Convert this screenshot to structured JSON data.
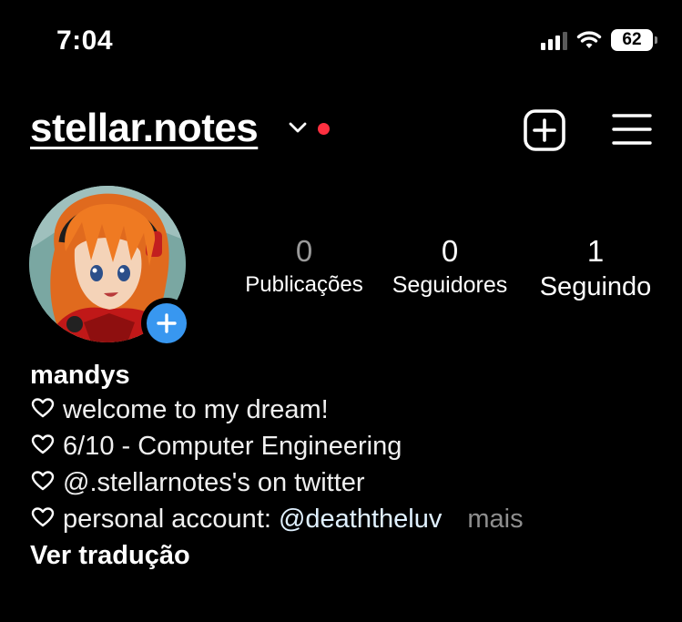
{
  "status_bar": {
    "time": "7:04",
    "battery": "62",
    "icons": [
      "signal-icon",
      "wifi-icon",
      "battery-icon"
    ]
  },
  "header": {
    "username": "stellar.notes",
    "icons": [
      "chevron-down-icon",
      "notification-dot-icon",
      "create-post-icon",
      "menu-icon"
    ],
    "accent_color": "#ff3040"
  },
  "profile": {
    "avatar": "anime-character-avatar",
    "add_story_color": "#3897f0"
  },
  "stats": {
    "posts": {
      "value": "0",
      "label": "Publicações"
    },
    "followers": {
      "value": "0",
      "label": "Seguidores"
    },
    "following": {
      "value": "1",
      "label": "Seguindo"
    }
  },
  "bio": {
    "name": "mandys",
    "lines": [
      "welcome to my dream!",
      "6/10 - Computer Engineering",
      "@.stellarnotes's on twitter"
    ],
    "last_line_prefix": "personal account: ",
    "last_line_mention": "@deaththeluv",
    "more": "mais",
    "translate": "Ver tradução"
  }
}
